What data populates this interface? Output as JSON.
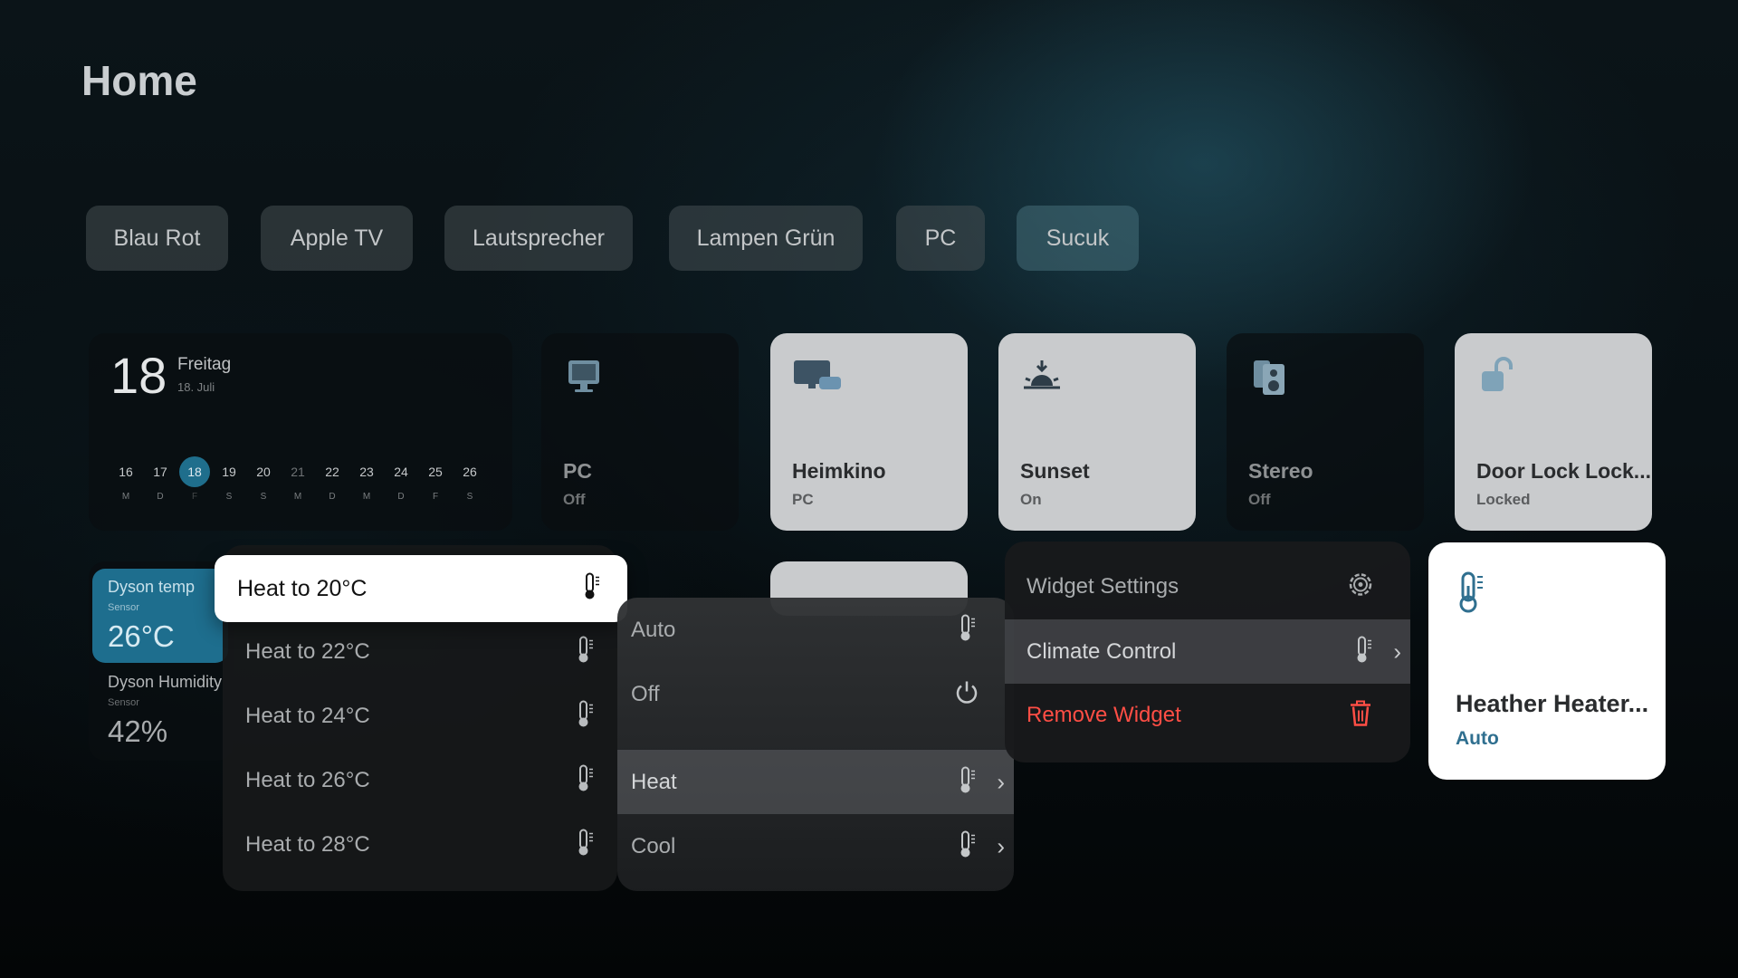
{
  "page": {
    "title": "Home"
  },
  "scenes": [
    {
      "label": "Blau Rot"
    },
    {
      "label": "Apple TV"
    },
    {
      "label": "Lautsprecher"
    },
    {
      "label": "Lampen Grün"
    },
    {
      "label": "PC"
    },
    {
      "label": "Sucuk"
    }
  ],
  "calendar": {
    "day": "18",
    "weekday": "Freitag",
    "date": "18. Juli",
    "days": [
      {
        "num": "16",
        "letter": "M"
      },
      {
        "num": "17",
        "letter": "D"
      },
      {
        "num": "18",
        "letter": "F"
      },
      {
        "num": "19",
        "letter": "S"
      },
      {
        "num": "20",
        "letter": "S"
      },
      {
        "num": "21",
        "letter": "M"
      },
      {
        "num": "22",
        "letter": "D"
      },
      {
        "num": "23",
        "letter": "M"
      },
      {
        "num": "24",
        "letter": "D"
      },
      {
        "num": "25",
        "letter": "F"
      },
      {
        "num": "26",
        "letter": "S"
      }
    ],
    "today_color": "#1f6e8c"
  },
  "tiles": {
    "pc": {
      "name": "PC",
      "status": "Off",
      "icon": "monitor-icon"
    },
    "heimkino": {
      "name": "Heimkino",
      "status": "PC",
      "icon": "monitor-devices-icon"
    },
    "sunset": {
      "name": "Sunset",
      "status": "On",
      "icon": "sunset-icon"
    },
    "stereo": {
      "name": "Stereo",
      "status": "Off",
      "icon": "speaker-icon"
    },
    "door_lock": {
      "name": "Door Lock Lock...",
      "status": "Locked",
      "icon": "padlock-icon"
    },
    "heater": {
      "name": "Heather Heater...",
      "status": "Auto",
      "icon": "thermometer-icon",
      "status_color": "#2f6f8f"
    }
  },
  "sensors": {
    "temp": {
      "name": "Dyson temp",
      "sub": "Sensor",
      "value": "26°C"
    },
    "humidity": {
      "name": "Dyson Humidity",
      "sub": "Sensor",
      "value": "42%"
    }
  },
  "heat_menu": {
    "selected": "Heat to 20°C",
    "items": [
      {
        "label": "Heat to 22°C"
      },
      {
        "label": "Heat to 24°C"
      },
      {
        "label": "Heat to 26°C"
      },
      {
        "label": "Heat to 28°C"
      }
    ]
  },
  "mode_menu": {
    "items": [
      {
        "label": "Auto",
        "icon": "thermometer-icon"
      },
      {
        "label": "Off",
        "icon": "power-icon"
      },
      {
        "label": "Heat",
        "icon": "thermometer-icon"
      },
      {
        "label": "Cool",
        "icon": "thermometer-icon"
      }
    ]
  },
  "context_menu": {
    "items": [
      {
        "label": "Widget Settings",
        "icon": "gear-icon"
      },
      {
        "label": "Climate Control",
        "icon": "thermometer-icon"
      },
      {
        "label": "Remove Widget",
        "icon": "trash-icon"
      }
    ],
    "destructive_color": "#ff4e45"
  }
}
